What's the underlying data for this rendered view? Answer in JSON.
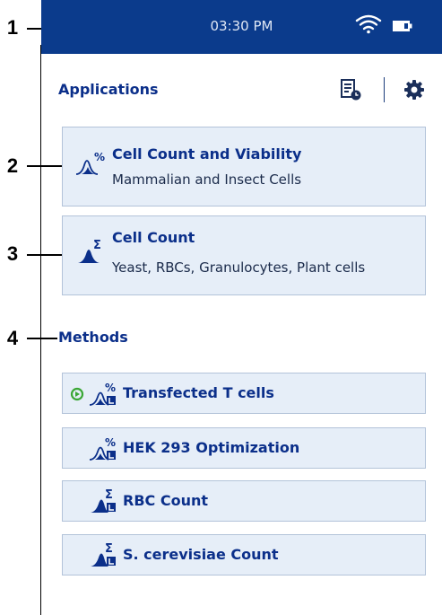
{
  "callouts": [
    "1",
    "2",
    "3",
    "4"
  ],
  "status": {
    "time": "03:30 PM"
  },
  "applications": {
    "heading": "Applications",
    "items": [
      {
        "title": "Cell Count and Viability",
        "subtitle": "Mammalian and Insect Cells",
        "icon": "viability-percent-icon"
      },
      {
        "title": "Cell Count",
        "subtitle": "Yeast, RBCs, Granulocytes, Plant cells",
        "icon": "cell-count-sigma-icon"
      }
    ]
  },
  "methods": {
    "heading": "Methods",
    "items": [
      {
        "label": "Transfected T cells",
        "icon": "viability-method-icon",
        "active": true
      },
      {
        "label": "HEK 293 Optimization",
        "icon": "viability-method-icon"
      },
      {
        "label": "RBC Count",
        "icon": "count-method-icon"
      },
      {
        "label": "S. cerevisiae Count",
        "icon": "count-method-icon"
      }
    ]
  },
  "colors": {
    "header": "#0b3b8c",
    "accent": "#0b2f8a",
    "card": "#e6eef8",
    "active": "#3aa735"
  }
}
